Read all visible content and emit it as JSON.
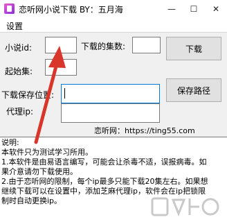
{
  "window": {
    "title": "恋听网小说下载 BY：五月海",
    "minimize_glyph": "—",
    "maximize_glyph": "☐",
    "close_glyph": "✕"
  },
  "menu": {
    "settings": "设置"
  },
  "form": {
    "novel_id_label": "小说id:",
    "novel_id_value": "",
    "episodes_label": "下载的集数:",
    "episodes_value": "",
    "start_label": "起始集:",
    "start_value": "",
    "save_path_label": "下载保存位置:",
    "save_path_value": "",
    "proxy_label": "代理ip:",
    "proxy_value": ""
  },
  "buttons": {
    "download": "下载",
    "save_path": "保存路径"
  },
  "website": "恋听网：https://ting55.com",
  "info": {
    "lines": [
      "说明:",
      "本软件只为测试学习所用。",
      "1.本软件是由易语言编写，可能会让杀毒不适，误报病毒。如",
      "果介意请勿下载使用。",
      "2.由于恋听网的限制，每个ip最多只能下载20集左右。如果想",
      "继续下载可以在设置中，添加芝麻代理ip，软件会在ip把锁限",
      "制时自动更换ip。"
    ]
  },
  "colors": {
    "arrow": "#d9362b",
    "window_bg": "#f0f0f0"
  },
  "icons": {
    "app": "app-icon"
  }
}
